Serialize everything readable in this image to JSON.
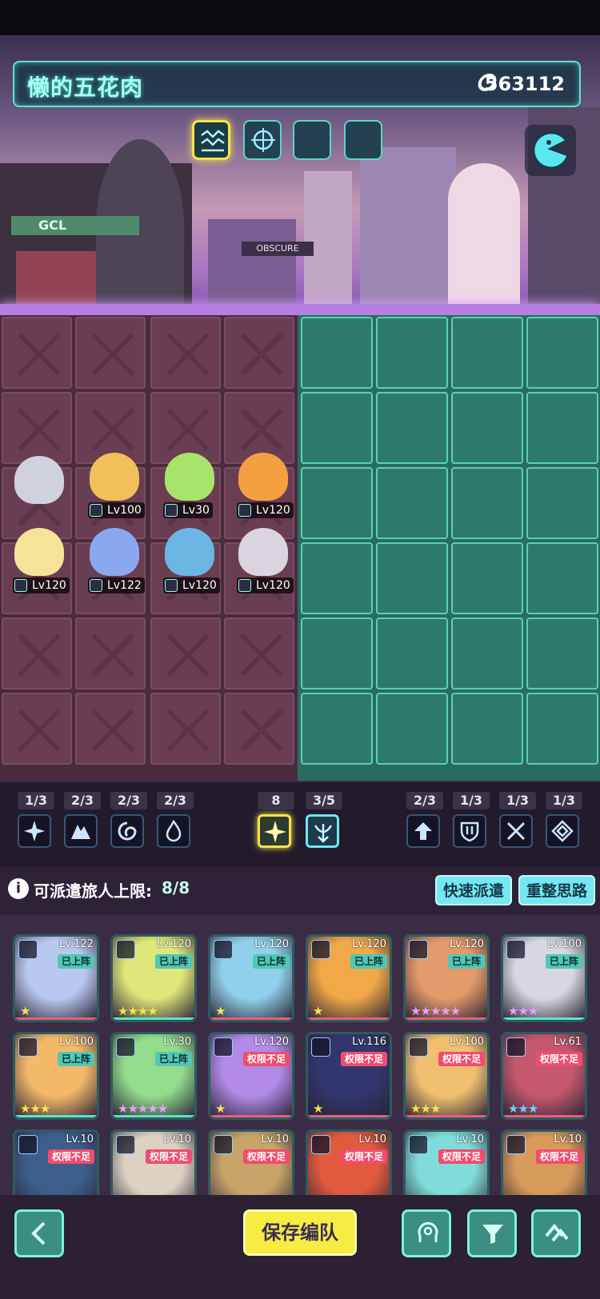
{
  "header": {
    "player_name": "懒的五花肉",
    "power_value": "563112",
    "sign_text": "GCL",
    "billboard_text": "OBSCURE"
  },
  "deployed_units": [
    {
      "level": "Lv100",
      "color": "#f0c05a"
    },
    {
      "level": "Lv30",
      "color": "#a6e46a"
    },
    {
      "level": "Lv120",
      "color": "#f4a040"
    },
    {
      "level": "Lv120",
      "color": "#f5e39a"
    },
    {
      "level": "Lv122",
      "color": "#8aa8f0"
    },
    {
      "level": "Lv120",
      "color": "#6cb6e6"
    },
    {
      "level": "Lv120",
      "color": "#d9d4de"
    }
  ],
  "factions_left": [
    {
      "count": "1/3",
      "icon": "star-burst-icon"
    },
    {
      "count": "2/3",
      "icon": "mountain-icon"
    },
    {
      "count": "2/3",
      "icon": "swirl-icon"
    },
    {
      "count": "2/3",
      "icon": "flame-icon"
    }
  ],
  "factions_mid": [
    {
      "count": "8",
      "icon": "sparkle-icon"
    },
    {
      "count": "3/5",
      "icon": "bow-icon"
    }
  ],
  "factions_right": [
    {
      "count": "2/3",
      "icon": "arrow-up-icon"
    },
    {
      "count": "1/3",
      "icon": "shield-icon"
    },
    {
      "count": "1/3",
      "icon": "crossed-swords-icon"
    },
    {
      "count": "1/3",
      "icon": "gem-icon"
    }
  ],
  "roster_header": {
    "limit_label": "可派遣旅人上限:",
    "limit_value": "8/8",
    "quick_dispatch": "快速派遣",
    "reset": "重整思路"
  },
  "roster": [
    {
      "level": "Lv.122",
      "tag": "已上阵",
      "state": "on",
      "stars": "★",
      "color": "#b9c8f0"
    },
    {
      "level": "Lv.120",
      "tag": "已上阵",
      "state": "on",
      "stars": "★★★★",
      "color": "#dfe67a"
    },
    {
      "level": "Lv.120",
      "tag": "已上阵",
      "state": "on",
      "stars": "★",
      "color": "#8fd0ea"
    },
    {
      "level": "Lv.120",
      "tag": "已上阵",
      "state": "on",
      "stars": "★",
      "color": "#f0a848"
    },
    {
      "level": "Lv.120",
      "tag": "已上阵",
      "state": "on",
      "stars": "★★★★★",
      "color": "#e49a6a"
    },
    {
      "level": "Lv.100",
      "tag": "已上阵",
      "state": "on",
      "stars": "★★★",
      "color": "#d8d6e0"
    },
    {
      "level": "Lv.100",
      "tag": "已上阵",
      "state": "on",
      "stars": "★★★",
      "color": "#f3b868"
    },
    {
      "level": "Lv.30",
      "tag": "已上阵",
      "state": "on",
      "stars": "★★★★★",
      "color": "#92dc8c"
    },
    {
      "level": "Lv.120",
      "tag": "权限不足",
      "state": "no",
      "stars": "★",
      "color": "#b28ae8"
    },
    {
      "level": "Lv.116",
      "tag": "权限不足",
      "state": "no",
      "stars": "★",
      "color": "#32366e"
    },
    {
      "level": "Lv.100",
      "tag": "权限不足",
      "state": "no",
      "stars": "★★★",
      "color": "#f0c070"
    },
    {
      "level": "Lv.61",
      "tag": "权限不足",
      "state": "no",
      "stars": "★★★",
      "color": "#c6586e"
    },
    {
      "level": "Lv.10",
      "tag": "权限不足",
      "state": "no",
      "stars": "",
      "color": "#3d5e8a"
    },
    {
      "level": "Lv.10",
      "tag": "权限不足",
      "state": "no",
      "stars": "",
      "color": "#ddd2c2"
    },
    {
      "level": "Lv.10",
      "tag": "权限不足",
      "state": "no",
      "stars": "",
      "color": "#c9a46a"
    },
    {
      "level": "Lv.10",
      "tag": "权限不足",
      "state": "no",
      "stars": "",
      "color": "#e25a3e"
    },
    {
      "level": "Lv.10",
      "tag": "权限不足",
      "state": "no",
      "stars": "",
      "color": "#7fdcd8"
    },
    {
      "level": "Lv.10",
      "tag": "权限不足",
      "state": "no",
      "stars": "",
      "color": "#d89a5a"
    }
  ],
  "bottom": {
    "save_label": "保存编队"
  }
}
